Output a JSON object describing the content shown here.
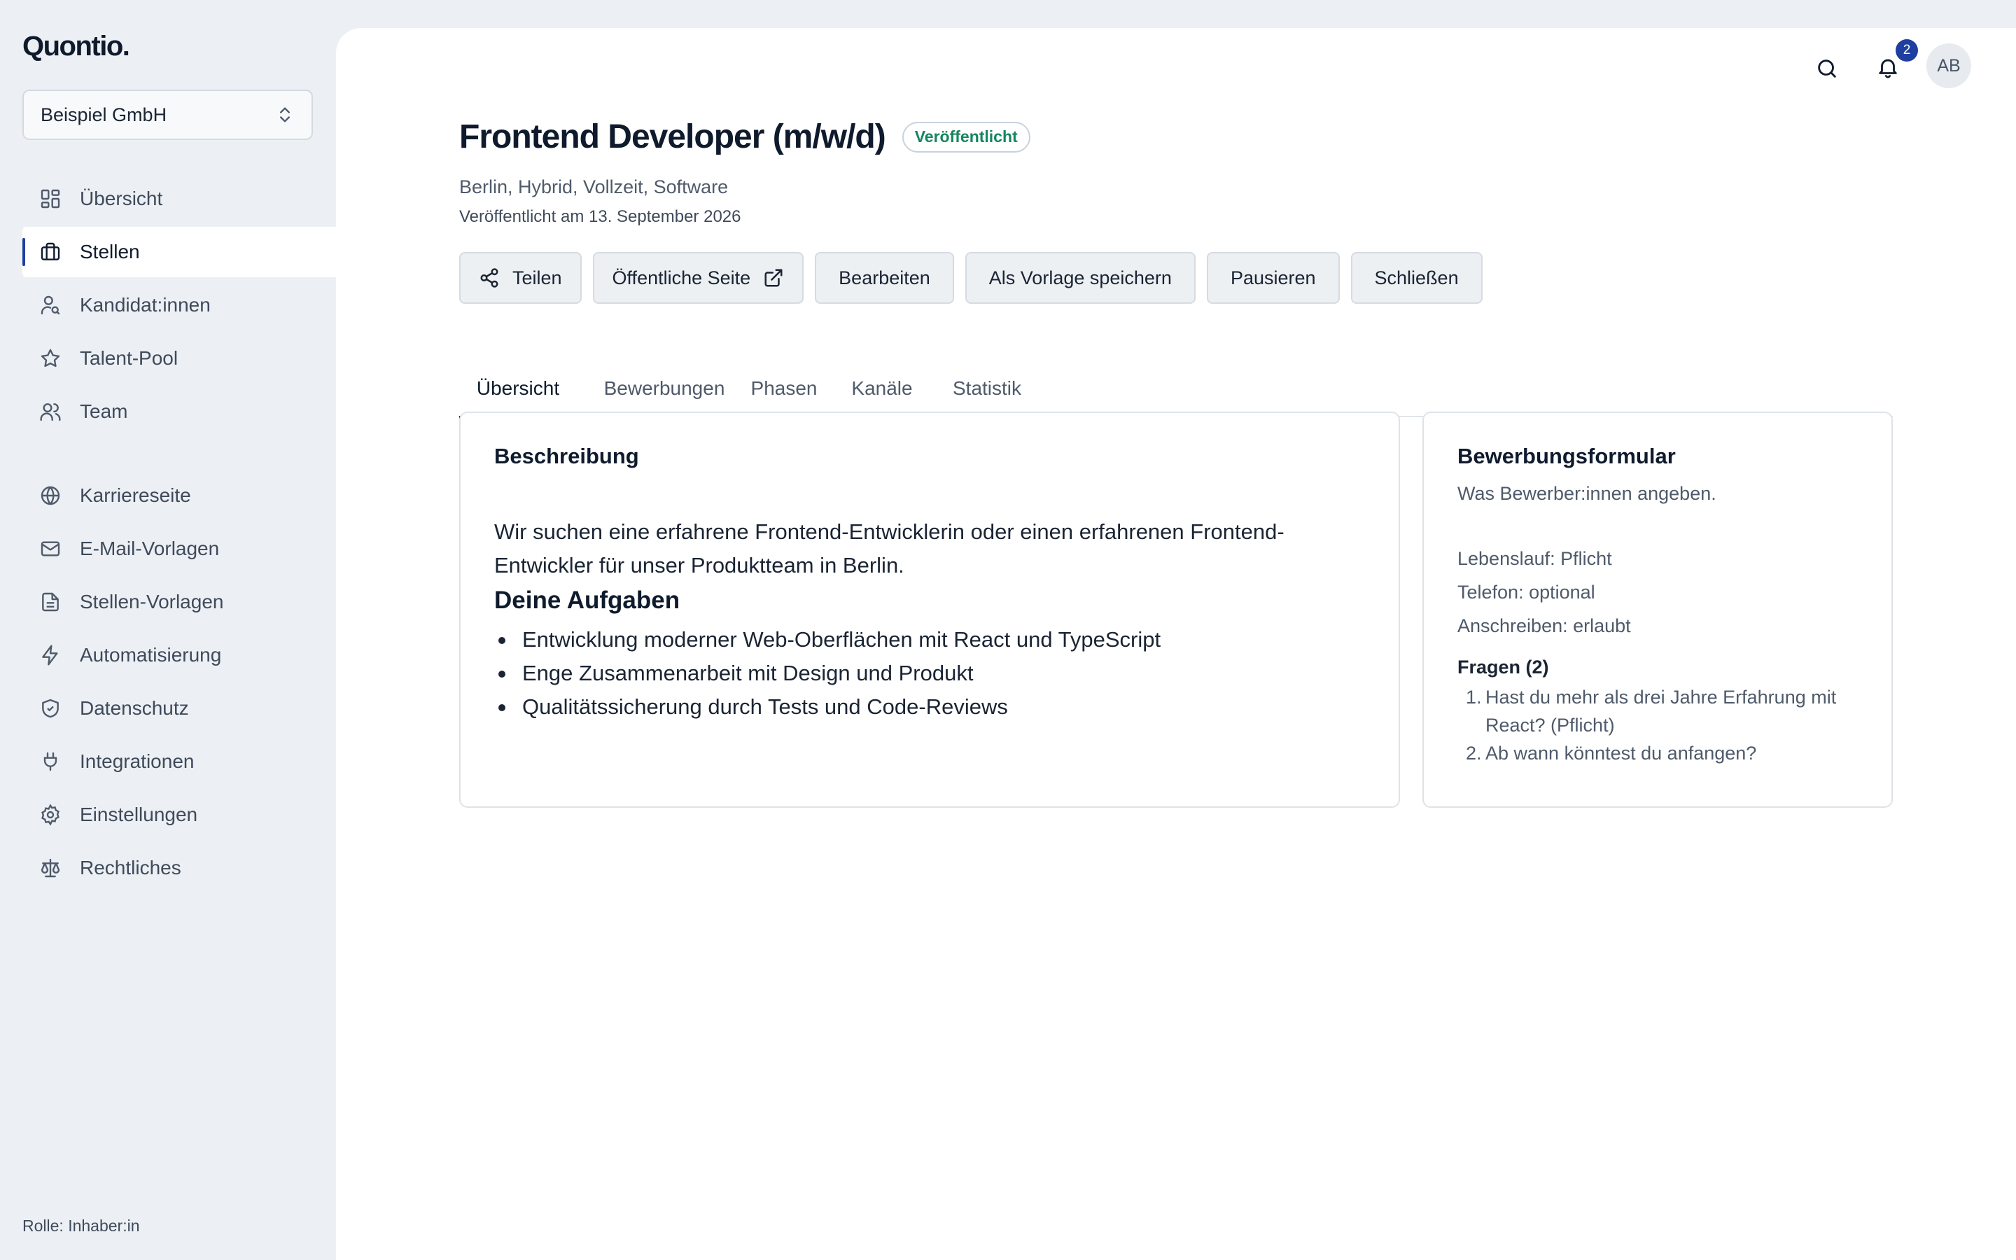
{
  "brand": {
    "logo": "Quontio."
  },
  "sidebar": {
    "org": "Beispiel GmbH",
    "items": [
      {
        "label": "Übersicht",
        "icon": "dashboard-icon"
      },
      {
        "label": "Stellen",
        "icon": "briefcase-icon",
        "active": true
      },
      {
        "label": "Kandidat:innen",
        "icon": "user-search-icon"
      },
      {
        "label": "Talent-Pool",
        "icon": "star-icon"
      },
      {
        "label": "Team",
        "icon": "users-icon"
      },
      {
        "label": "Karriereseite",
        "icon": "globe-icon"
      },
      {
        "label": "E-Mail-Vorlagen",
        "icon": "mail-icon"
      },
      {
        "label": "Stellen-Vorlagen",
        "icon": "file-text-icon"
      },
      {
        "label": "Automatisierung",
        "icon": "lightning-icon"
      },
      {
        "label": "Datenschutz",
        "icon": "shield-check-icon"
      },
      {
        "label": "Integrationen",
        "icon": "plug-icon"
      },
      {
        "label": "Einstellungen",
        "icon": "gear-icon"
      },
      {
        "label": "Rechtliches",
        "icon": "scale-icon"
      }
    ],
    "role": "Rolle: Inhaber:in"
  },
  "topbar": {
    "notification_count": "2",
    "avatar_initials": "AB"
  },
  "job": {
    "title": "Frontend Developer (m/w/d)",
    "status": "Veröffentlicht",
    "meta": "Berlin, Hybrid, Vollzeit, Software",
    "published": "Veröffentlicht am 13. September 2026"
  },
  "actions": {
    "share": "Teilen",
    "public_page": "Öffentliche Seite",
    "edit": "Bearbeiten",
    "save_template": "Als Vorlage speichern",
    "pause": "Pausieren",
    "close": "Schließen"
  },
  "tabs": [
    "Übersicht",
    "Bewerbungen",
    "Phasen",
    "Kanäle",
    "Statistik"
  ],
  "description": {
    "heading": "Beschreibung",
    "intro": "Wir suchen eine erfahrene Frontend-Entwicklerin oder einen erfahrenen Frontend-Entwickler für unser Produktteam in Berlin.",
    "tasks_heading": "Deine Aufgaben",
    "tasks": [
      "Entwicklung moderner Web-Oberflächen mit React und TypeScript",
      "Enge Zusammenarbeit mit Design und Produkt",
      "Qualitätssicherung durch Tests und Code-Reviews"
    ]
  },
  "form": {
    "heading": "Bewerbungsformular",
    "subtitle": "Was Bewerber:innen angeben.",
    "fields": [
      "Lebenslauf: Pflicht",
      "Telefon: optional",
      "Anschreiben: erlaubt"
    ],
    "questions_heading": "Fragen (2)",
    "questions": [
      "Hast du mehr als drei Jahre Erfahrung mit React? (Pflicht)",
      "Ab wann könntest du anfangen?"
    ]
  },
  "colors": {
    "accent": "#1e3ea0",
    "published": "#14865e"
  }
}
